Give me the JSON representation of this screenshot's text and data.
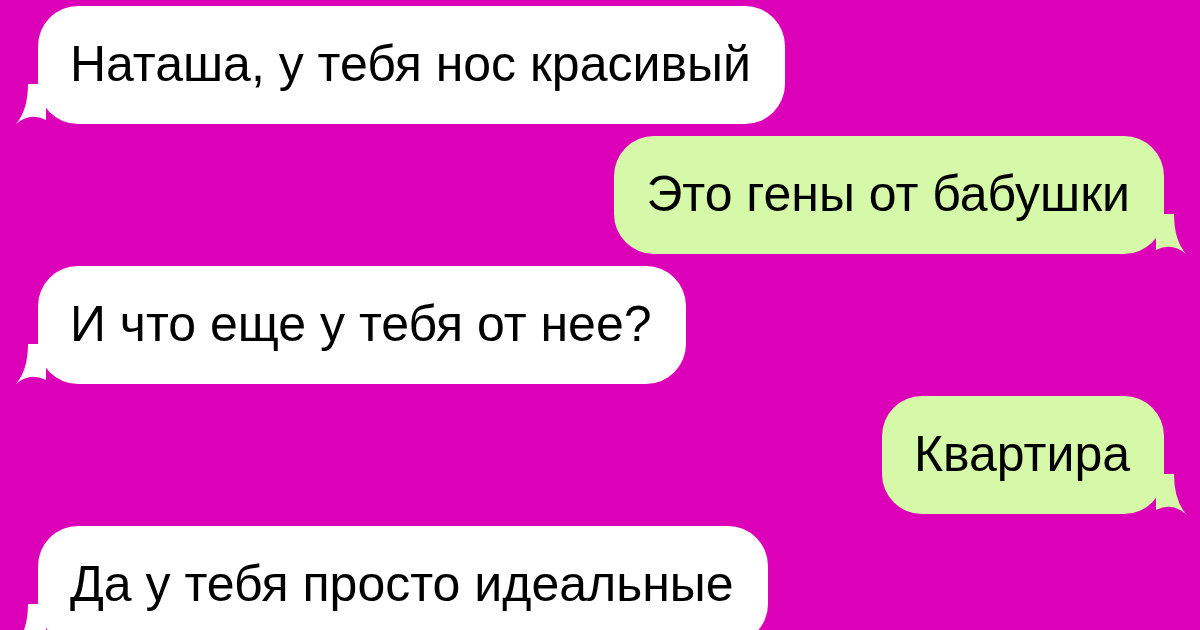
{
  "messages": [
    {
      "kind": "received",
      "text": "Наташа, у тебя нос красивый"
    },
    {
      "kind": "sent",
      "text": "Это гены от бабушки"
    },
    {
      "kind": "received",
      "text": "И что еще у тебя от нее?"
    },
    {
      "kind": "sent",
      "text": "Квартира"
    },
    {
      "kind": "received",
      "text": "Да у тебя просто идеальные"
    }
  ]
}
